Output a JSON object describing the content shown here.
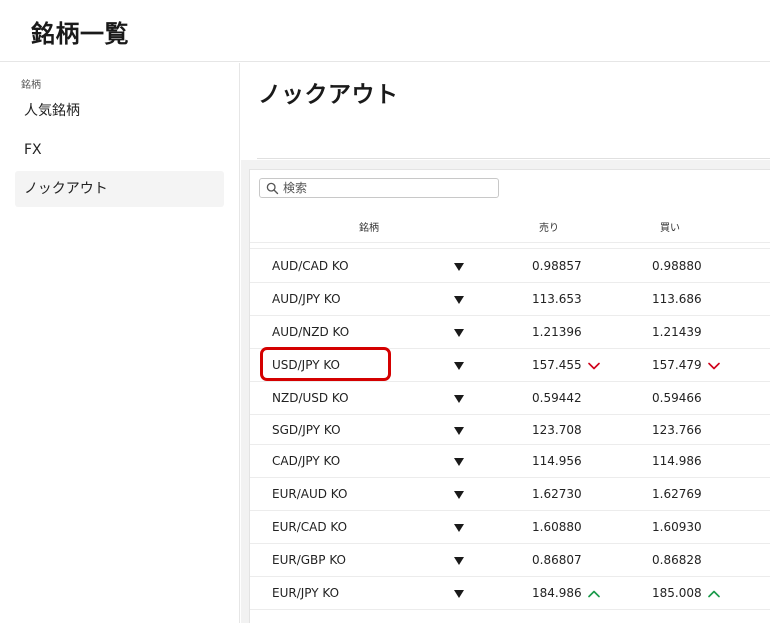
{
  "header": {
    "title": "銘柄一覧"
  },
  "sidebar": {
    "section_label": "銘柄",
    "items": [
      {
        "label": "人気銘柄"
      },
      {
        "label": "FX"
      },
      {
        "label": "ノックアウト",
        "active": true
      }
    ]
  },
  "main": {
    "page_title": "ノックアウト",
    "search": {
      "placeholder": "検索",
      "value": ""
    },
    "columns": {
      "symbol": "銘柄",
      "bid": "売り",
      "ask": "買い"
    },
    "rows": [
      {
        "symbol": "AUD/CAD KO",
        "bid": "0.98857",
        "ask": "0.98880",
        "trend": ""
      },
      {
        "symbol": "AUD/JPY KO",
        "bid": "113.653",
        "ask": "113.686",
        "trend": ""
      },
      {
        "symbol": "AUD/NZD KO",
        "bid": "1.21396",
        "ask": "1.21439",
        "trend": ""
      },
      {
        "symbol": "USD/JPY KO",
        "bid": "157.455",
        "ask": "157.479",
        "trend": "down"
      },
      {
        "symbol": "NZD/USD KO",
        "bid": "0.59442",
        "ask": "0.59466",
        "trend": ""
      },
      {
        "symbol": "SGD/JPY KO",
        "bid": "123.708",
        "ask": "123.766",
        "trend": ""
      },
      {
        "symbol": "CAD/JPY KO",
        "bid": "114.956",
        "ask": "114.986",
        "trend": ""
      },
      {
        "symbol": "EUR/AUD KO",
        "bid": "1.62730",
        "ask": "1.62769",
        "trend": ""
      },
      {
        "symbol": "EUR/CAD KO",
        "bid": "1.60880",
        "ask": "1.60930",
        "trend": ""
      },
      {
        "symbol": "EUR/GBP KO",
        "bid": "0.86807",
        "ask": "0.86828",
        "trend": ""
      },
      {
        "symbol": "EUR/JPY KO",
        "bid": "184.986",
        "ask": "185.008",
        "trend": "up"
      }
    ]
  },
  "colors": {
    "down": "#d0021b",
    "up": "#1a9a4a",
    "highlight": "#d40000"
  },
  "icons": {
    "search": "search-icon",
    "dropdown": "caret-down-icon",
    "down": "chevron-down-icon",
    "up": "chevron-up-icon"
  }
}
